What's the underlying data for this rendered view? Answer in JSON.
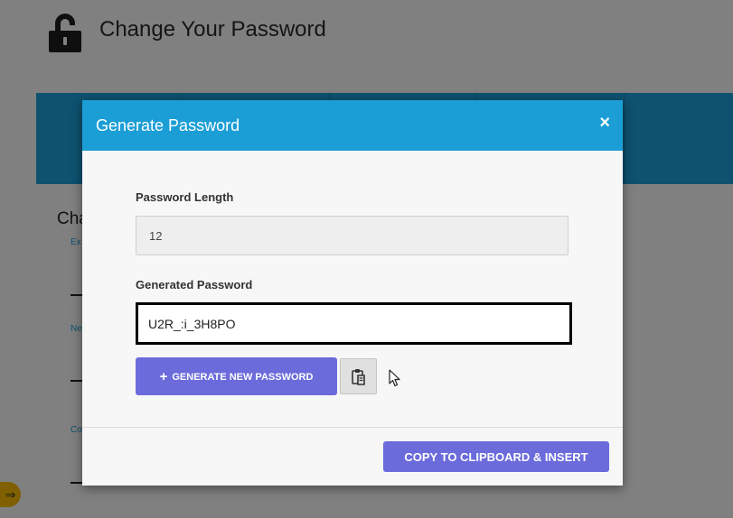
{
  "page": {
    "title": "Change Your Password",
    "section_title": "Cha",
    "small_labels": [
      "Ex",
      "Ne",
      "Co"
    ],
    "lock_icon": "lock-icon",
    "help_icon": "arrow-right-icon",
    "help_glyph": "⇒"
  },
  "modal": {
    "title": "Generate Password",
    "close_glyph": "×",
    "length_label": "Password Length",
    "length_value": "12",
    "generated_label": "Generated Password",
    "generated_value": "U2R_:i_3H8PO",
    "generate_plus": "+",
    "generate_label": "GENERATE NEW PASSWORD",
    "clipboard_icon": "clipboard-icon",
    "copy_insert_label": "COPY TO CLIPBOARD & INSERT"
  },
  "colors": {
    "accent": "#1b9ed6",
    "button": "#6b6bdc",
    "help": "#f5b800"
  }
}
